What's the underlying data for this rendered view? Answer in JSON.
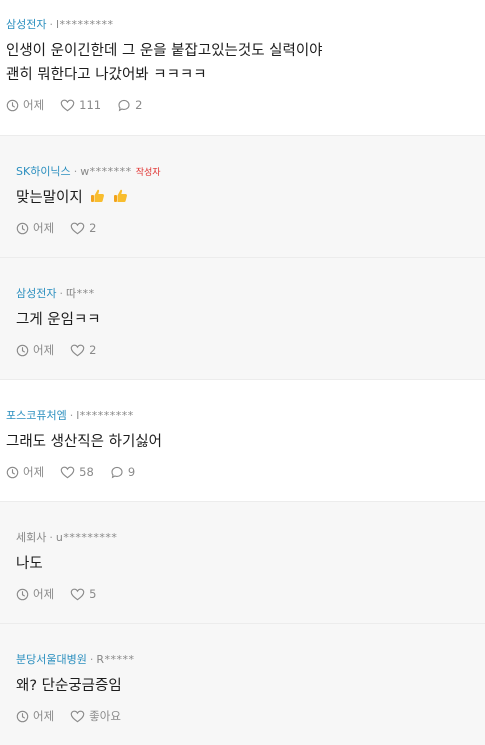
{
  "comments": [
    {
      "company": "삼성전자",
      "user": "l*********",
      "author_tag": "",
      "lines": [
        "인생이 운이긴한데 그 운을 붙잡고있는것도 실력이야",
        "괜히 뭐한다고 나갔어봐 ㅋㅋㅋㅋ"
      ],
      "time": "어제",
      "likes": "111",
      "replies": "2",
      "reply": false
    },
    {
      "company": "SK하이닉스",
      "user": "w*******",
      "author_tag": "작성자",
      "lines": [
        "맞는말이지"
      ],
      "thumbs": 2,
      "time": "어제",
      "likes": "2",
      "replies": "",
      "reply": true
    },
    {
      "company": "삼성전자",
      "user": "따***",
      "author_tag": "",
      "lines": [
        "그게 운임ㅋㅋ"
      ],
      "time": "어제",
      "likes": "2",
      "replies": "",
      "reply": true
    },
    {
      "company": "포스코퓨처엠",
      "user": "l*********",
      "author_tag": "",
      "lines": [
        "그래도 생산직은 하기싫어"
      ],
      "time": "어제",
      "likes": "58",
      "replies": "9",
      "reply": false
    },
    {
      "company": "세회사",
      "user": "u*********",
      "author_tag": "",
      "lines": [
        "나도"
      ],
      "time": "어제",
      "likes": "5",
      "replies": "",
      "reply": true,
      "company_gray": true
    },
    {
      "company": "분당서울대병원",
      "user": "R*****",
      "author_tag": "",
      "lines": [
        "왜? 단순궁금증임"
      ],
      "time": "어제",
      "likes": "좋아요",
      "replies": "",
      "reply": true
    }
  ],
  "icons": {
    "time": "clock-icon",
    "like": "heart-icon",
    "reply": "speech-bubble-icon",
    "thumbs": "thumbs-up-emoji"
  },
  "colors": {
    "company": "#2b8fbf",
    "author_tag": "#e0302f",
    "reply_bg": "#f7f7f7"
  }
}
